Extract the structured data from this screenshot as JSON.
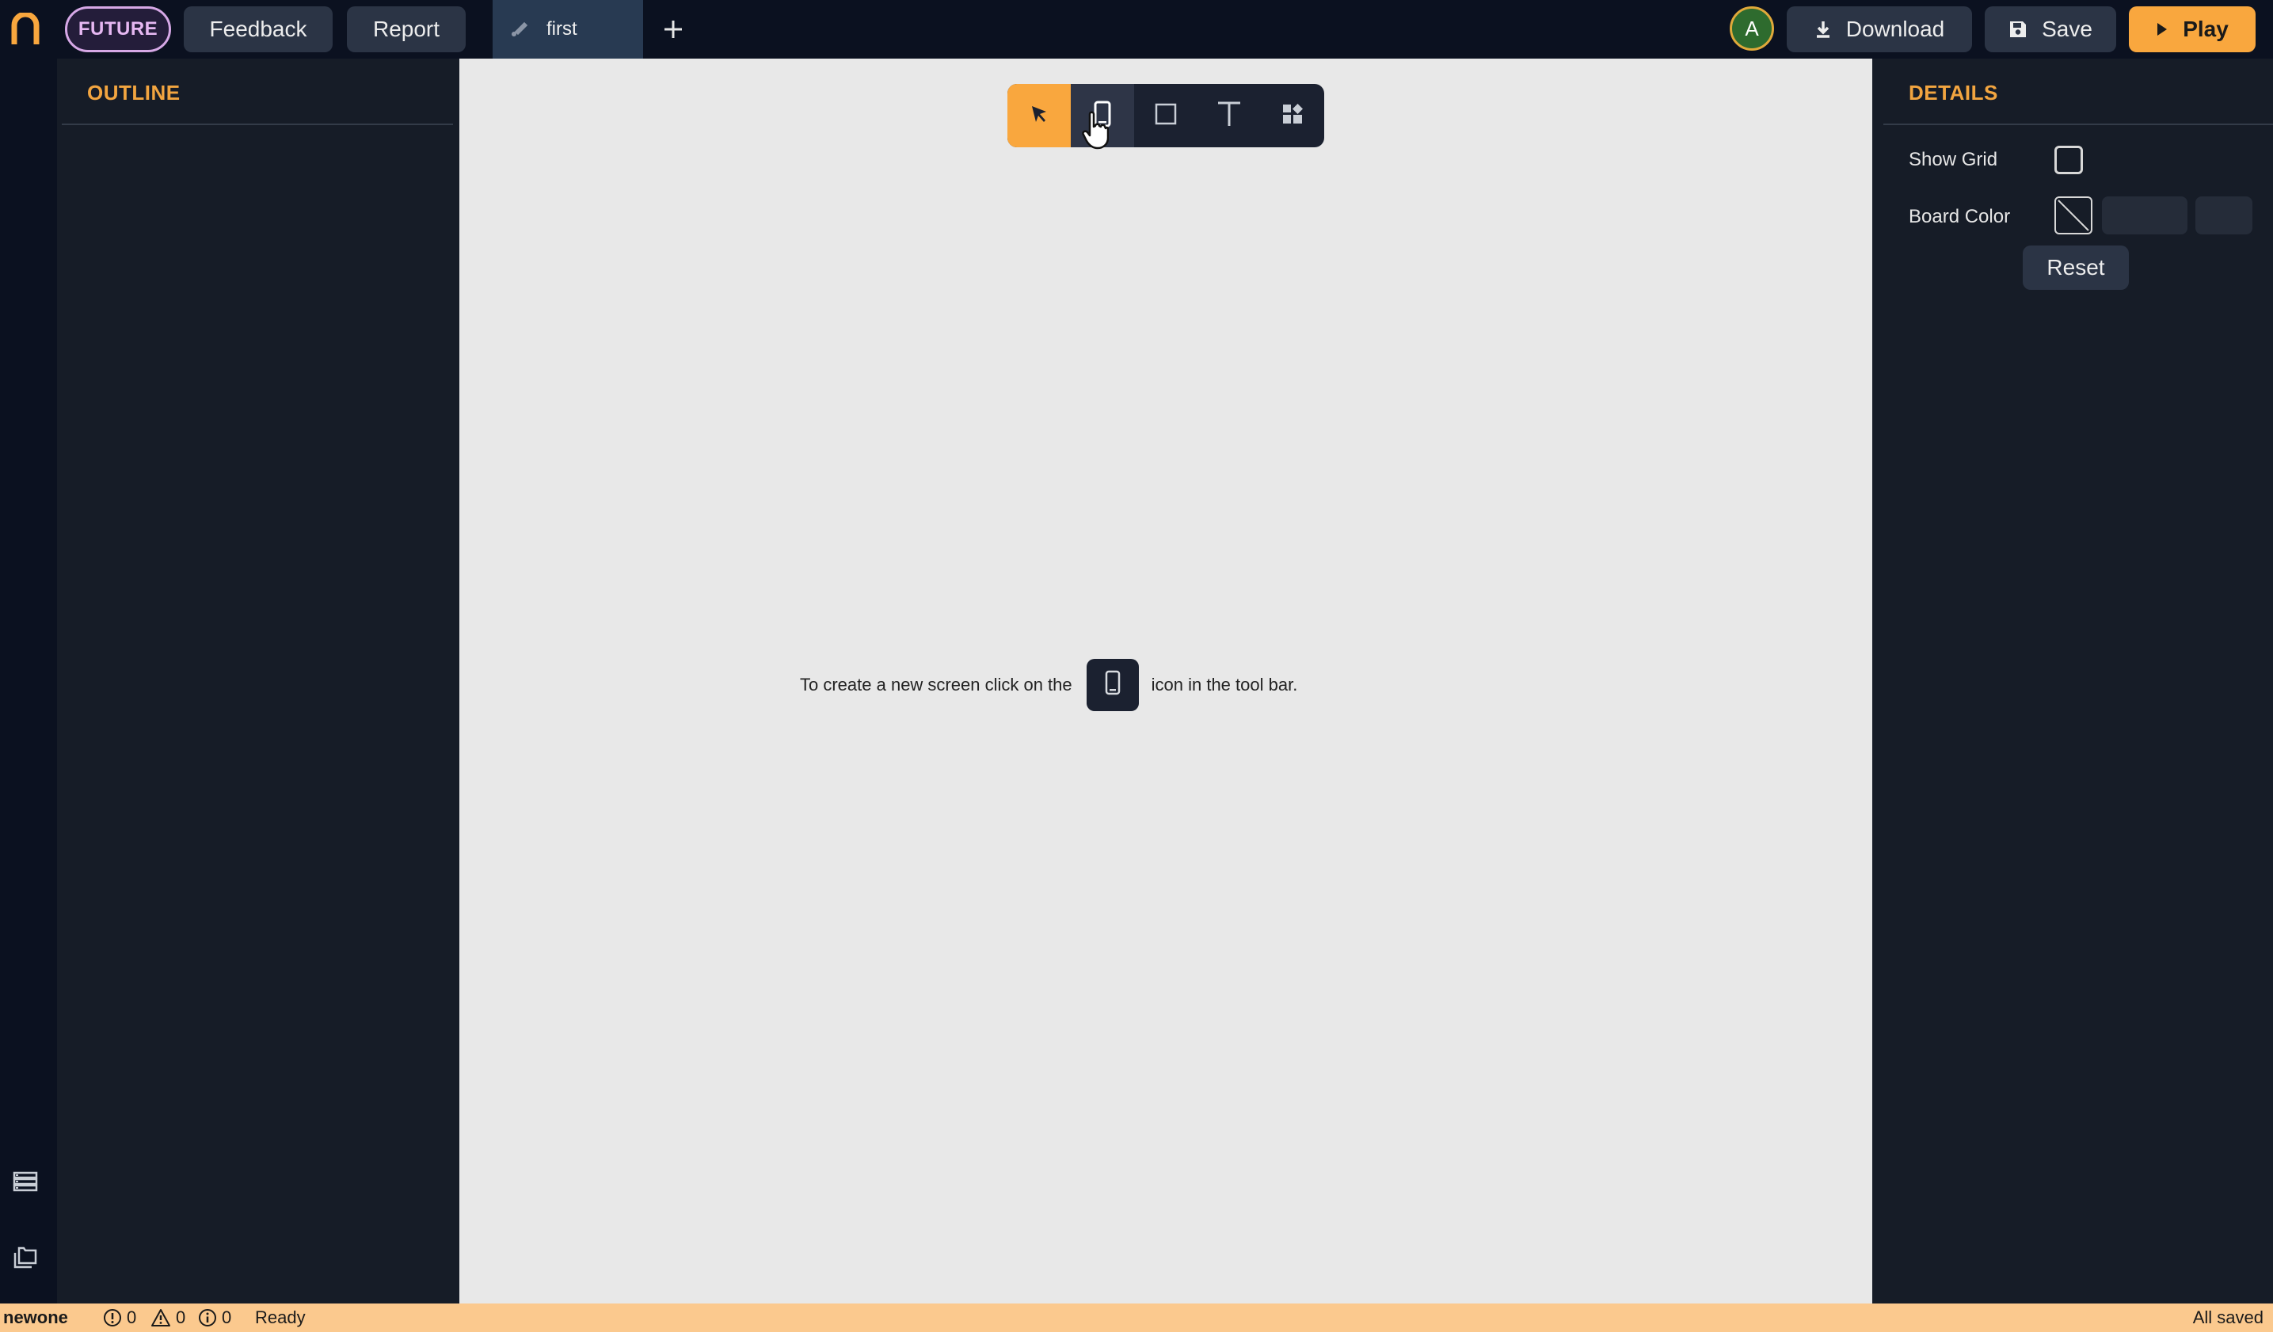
{
  "topbar": {
    "badge": "FUTURE",
    "feedback": "Feedback",
    "report": "Report",
    "tab": "first",
    "avatar": "A",
    "download": "Download",
    "save": "Save",
    "play": "Play"
  },
  "outline": {
    "title": "OUTLINE"
  },
  "canvas": {
    "toolbar": {
      "tools": [
        "select-icon",
        "phone-screen-icon",
        "rectangle-icon",
        "text-icon",
        "components-icon"
      ],
      "active": "select-icon"
    },
    "hint_before": "To create a new screen click on the",
    "hint_after": "icon in the tool bar."
  },
  "details": {
    "title": "DETAILS",
    "show_grid_label": "Show Grid",
    "show_grid_checked": false,
    "board_color_label": "Board Color",
    "reset": "Reset"
  },
  "statusbar": {
    "project": "newone",
    "errors": "0",
    "warnings": "0",
    "infos": "0",
    "status": "Ready",
    "saved": "All saved"
  },
  "colors": {
    "accent": "#f9a73e",
    "chrome": "#0b1120",
    "panel": "#161c27",
    "canvas": "#e8e8e8",
    "statusbar": "#fbc98e"
  }
}
